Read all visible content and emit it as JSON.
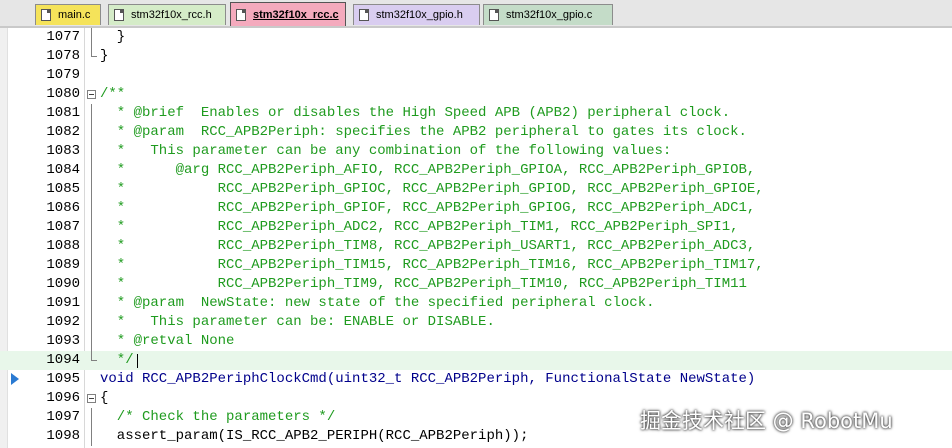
{
  "tabs": [
    {
      "label": "main.c",
      "color": "#f5e35a",
      "active": false
    },
    {
      "label": "stm32f10x_rcc.h",
      "color": "#d5ecc8",
      "active": false
    },
    {
      "label": "stm32f10x_rcc.c",
      "color": "#f4aabd",
      "active": true
    },
    {
      "label": "stm32f10x_gpio.h",
      "color": "#d9cdf0",
      "active": false
    },
    {
      "label": "stm32f10x_gpio.c",
      "color": "#c4dcc8",
      "active": false
    }
  ],
  "lines": [
    {
      "num": "1077",
      "text": "  }"
    },
    {
      "num": "1078",
      "text": "}"
    },
    {
      "num": "1079",
      "text": ""
    },
    {
      "num": "1080",
      "text": "/**"
    },
    {
      "num": "1081",
      "text": "  * @brief  Enables or disables the High Speed APB (APB2) peripheral clock."
    },
    {
      "num": "1082",
      "text": "  * @param  RCC_APB2Periph: specifies the APB2 peripheral to gates its clock."
    },
    {
      "num": "1083",
      "text": "  *   This parameter can be any combination of the following values:"
    },
    {
      "num": "1084",
      "text": "  *      @arg RCC_APB2Periph_AFIO, RCC_APB2Periph_GPIOA, RCC_APB2Periph_GPIOB,"
    },
    {
      "num": "1085",
      "text": "  *           RCC_APB2Periph_GPIOC, RCC_APB2Periph_GPIOD, RCC_APB2Periph_GPIOE,"
    },
    {
      "num": "1086",
      "text": "  *           RCC_APB2Periph_GPIOF, RCC_APB2Periph_GPIOG, RCC_APB2Periph_ADC1,"
    },
    {
      "num": "1087",
      "text": "  *           RCC_APB2Periph_ADC2, RCC_APB2Periph_TIM1, RCC_APB2Periph_SPI1,"
    },
    {
      "num": "1088",
      "text": "  *           RCC_APB2Periph_TIM8, RCC_APB2Periph_USART1, RCC_APB2Periph_ADC3,"
    },
    {
      "num": "1089",
      "text": "  *           RCC_APB2Periph_TIM15, RCC_APB2Periph_TIM16, RCC_APB2Periph_TIM17,"
    },
    {
      "num": "1090",
      "text": "  *           RCC_APB2Periph_TIM9, RCC_APB2Periph_TIM10, RCC_APB2Periph_TIM11"
    },
    {
      "num": "1091",
      "text": "  * @param  NewState: new state of the specified peripheral clock."
    },
    {
      "num": "1092",
      "text": "  *   This parameter can be: ENABLE or DISABLE."
    },
    {
      "num": "1093",
      "text": "  * @retval None"
    },
    {
      "num": "1094",
      "text": "  */"
    },
    {
      "num": "1095",
      "text": "void RCC_APB2PeriphClockCmd(uint32_t RCC_APB2Periph, FunctionalState NewState)"
    },
    {
      "num": "1096",
      "text": "{"
    },
    {
      "num": "1097",
      "text": "  /* Check the parameters */"
    },
    {
      "num": "1098",
      "text": "  assert_param(IS_RCC_APB2_PERIPH(RCC_APB2Periph));"
    }
  ],
  "watermark": "掘金技术社区 @ RobotMu",
  "colors": {
    "comment": "#1f9b1f",
    "keyword": "#00008b",
    "current_line": "#e8f7ea",
    "marker": "#2a7ad2"
  }
}
